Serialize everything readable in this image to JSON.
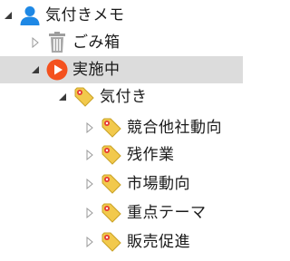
{
  "tree": {
    "root": {
      "label": "気付きメモ",
      "icon": "user-icon",
      "expanded": true
    },
    "trash": {
      "label": "ごみ箱",
      "icon": "trash-icon",
      "expanded": false
    },
    "in_progress": {
      "label": "実施中",
      "icon": "play-circle-icon",
      "expanded": true,
      "selected": true
    },
    "notice": {
      "label": "気付き",
      "icon": "tag-icon",
      "expanded": true
    },
    "children": [
      {
        "label": "競合他社動向",
        "icon": "tag-icon",
        "expanded": false
      },
      {
        "label": "残作業",
        "icon": "tag-icon",
        "expanded": false
      },
      {
        "label": "市場動向",
        "icon": "tag-icon",
        "expanded": false
      },
      {
        "label": "重点テーマ",
        "icon": "tag-icon",
        "expanded": false
      },
      {
        "label": "販売促進",
        "icon": "tag-icon",
        "expanded": false
      }
    ]
  },
  "colors": {
    "user_icon": "#1e88e5",
    "play_icon": "#f4511e",
    "tag_fill": "#f2c94c",
    "tag_dot": "#e53935",
    "selection": "#dcdcdc",
    "trash": "#9e9e9e"
  }
}
